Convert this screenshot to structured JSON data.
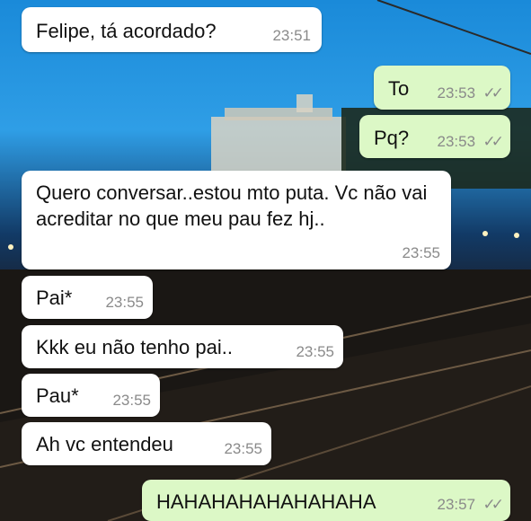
{
  "chat": {
    "messages": [
      {
        "side": "in",
        "text": "Felipe, tá acordado?",
        "time": "23:51"
      },
      {
        "side": "out",
        "text": "To",
        "time": "23:53",
        "ticks": "✓✓"
      },
      {
        "side": "out",
        "text": "Pq?",
        "time": "23:53",
        "ticks": "✓✓"
      },
      {
        "side": "in",
        "text": "Quero conversar..estou mto puta. Vc não vai acreditar no que meu pau fez hj..",
        "time": "23:55"
      },
      {
        "side": "in",
        "text": "Pai*",
        "time": "23:55"
      },
      {
        "side": "in",
        "text": "Kkk eu não tenho pai..",
        "time": "23:55"
      },
      {
        "side": "in",
        "text": "Pau*",
        "time": "23:55"
      },
      {
        "side": "in",
        "text": "Ah vc entendeu",
        "time": "23:55"
      },
      {
        "side": "out",
        "text": "HAHAHAHAHAHAHAHA",
        "time": "23:57",
        "ticks": "✓✓"
      }
    ]
  },
  "colors": {
    "incoming_bubble": "#ffffff",
    "outgoing_bubble": "#dcf8c6",
    "timestamp": "#8a8a8a"
  }
}
